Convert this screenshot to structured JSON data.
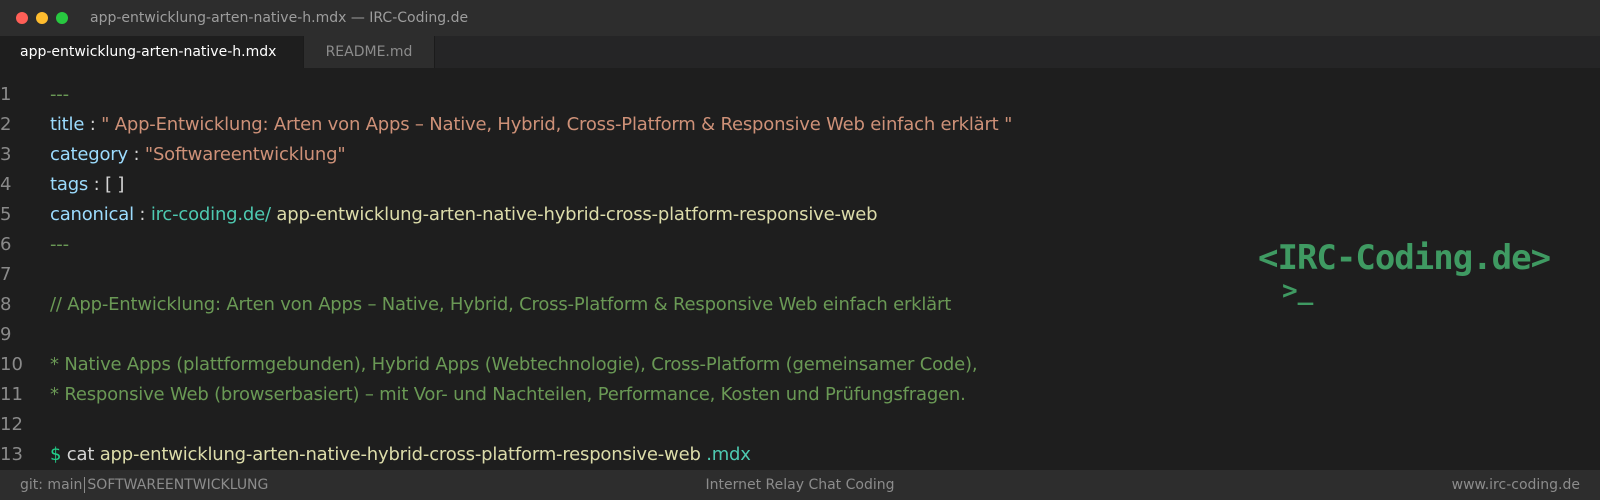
{
  "window": {
    "title": "app-entwicklung-arten-native-h.mdx — IRC-Coding.de",
    "traffic_lights": {
      "close": "#ff5f57",
      "minimize": "#febc2e",
      "maximize": "#28c840"
    }
  },
  "tabs": [
    {
      "label": "app-entwicklung-arten-native-h.mdx",
      "active": true
    },
    {
      "label": "README.md",
      "active": false
    }
  ],
  "editor": {
    "line_numbers": [
      "1",
      "2",
      "3",
      "4",
      "5",
      "6",
      "7",
      "8",
      "9",
      "10",
      "11",
      "12",
      "13"
    ],
    "frontmatter_open": "---",
    "title_key": "title",
    "title_colon": " : ",
    "title_value": "\" App-Entwicklung: Arten von Apps – Native, Hybrid, Cross-Platform & Responsive Web einfach erklärt \"",
    "category_key": "category",
    "category_colon": " : ",
    "category_value": "\"Softwareentwicklung\"",
    "tags_key": "tags",
    "tags_colon": " : ",
    "tags_value": "[  ]",
    "canonical_key": "canonical",
    "canonical_colon": " : ",
    "canonical_domain": "irc-coding.de/",
    "canonical_path": " app-entwicklung-arten-native-hybrid-cross-platform-responsive-web",
    "frontmatter_close": "---",
    "comment_line": "// App-Entwicklung: Arten von Apps – Native, Hybrid, Cross-Platform & Responsive Web einfach erklärt",
    "bullet_1": "* Native Apps (plattformgebunden), Hybrid Apps (Webtechnologie), Cross-Platform (gemeinsamer Code),",
    "bullet_2": "* Responsive Web (browserbasiert) – mit Vor- und Nachteilen, Performance, Kosten und Prüfungsfragen.",
    "prompt_symbol": "$",
    "command": " cat ",
    "command_file": "app-entwicklung-arten-native-hybrid-cross-platform-responsive-web",
    "command_ext": " .mdx"
  },
  "logo": {
    "text": "<IRC-Coding.de>",
    "prompt": ">_"
  },
  "statusbar": {
    "branch": "git: main",
    "category": "SOFTWAREENTWICKLUNG",
    "center": "Internet Relay Chat Coding",
    "right": "www.irc-coding.de"
  }
}
